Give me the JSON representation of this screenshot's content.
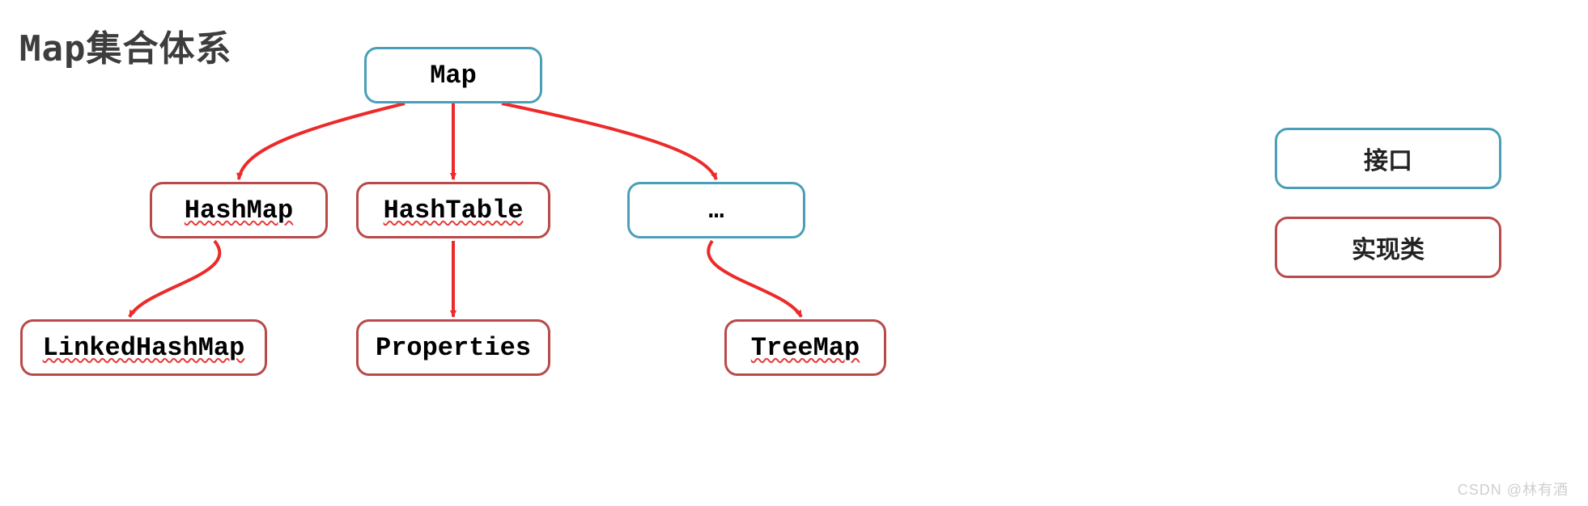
{
  "title": "Map集合体系",
  "nodes": {
    "map": {
      "label": "Map",
      "type": "interface",
      "wavy": false
    },
    "hashmap": {
      "label": "HashMap",
      "type": "impl",
      "wavy": true
    },
    "hashtable": {
      "label": "HashTable",
      "type": "impl",
      "wavy": true
    },
    "dots": {
      "label": "…",
      "type": "interface",
      "wavy": false
    },
    "linked": {
      "label": "LinkedHashMap",
      "type": "impl",
      "wavy": true
    },
    "properties": {
      "label": "Properties",
      "type": "impl",
      "wavy": false
    },
    "treemap": {
      "label": "TreeMap",
      "type": "impl",
      "wavy": true
    }
  },
  "legend": {
    "interface_label": "接口",
    "impl_label": "实现类"
  },
  "colors": {
    "interface_border": "#4a9fb8",
    "impl_border": "#b84a4a",
    "arrow": "#ed2a2a"
  },
  "watermark": "CSDN @林有酒"
}
